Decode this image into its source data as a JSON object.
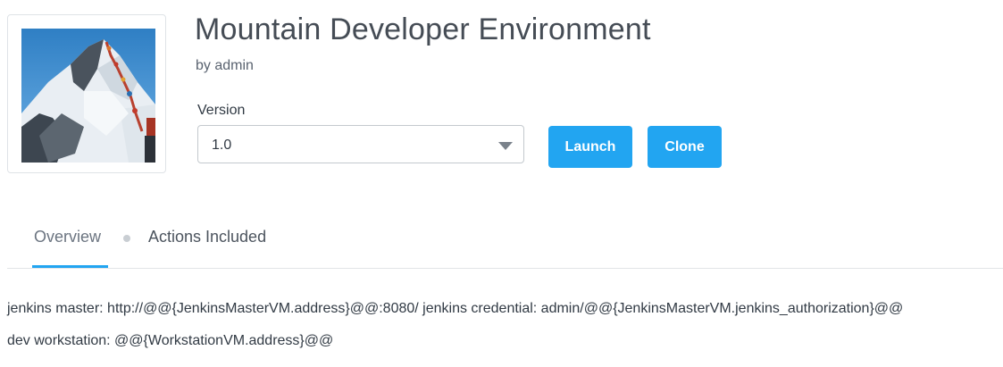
{
  "blueprint": {
    "title": "Mountain Developer Environment",
    "byline": "by admin",
    "thumbnail_icon": "mountain-climbers-image"
  },
  "version": {
    "label": "Version",
    "selected": "1.0"
  },
  "actions": {
    "launch_label": "Launch",
    "clone_label": "Clone",
    "accent_color": "#22a5f1"
  },
  "tabs": [
    {
      "label": "Overview",
      "active": true
    },
    {
      "label": "Actions Included",
      "active": false
    }
  ],
  "description": {
    "line1": "jenkins master: http://@@{JenkinsMasterVM.address}@@:8080/ jenkins credential: admin/@@{JenkinsMasterVM.jenkins_authorization}@@",
    "line2": "dev workstation: @@{WorkstationVM.address}@@"
  }
}
